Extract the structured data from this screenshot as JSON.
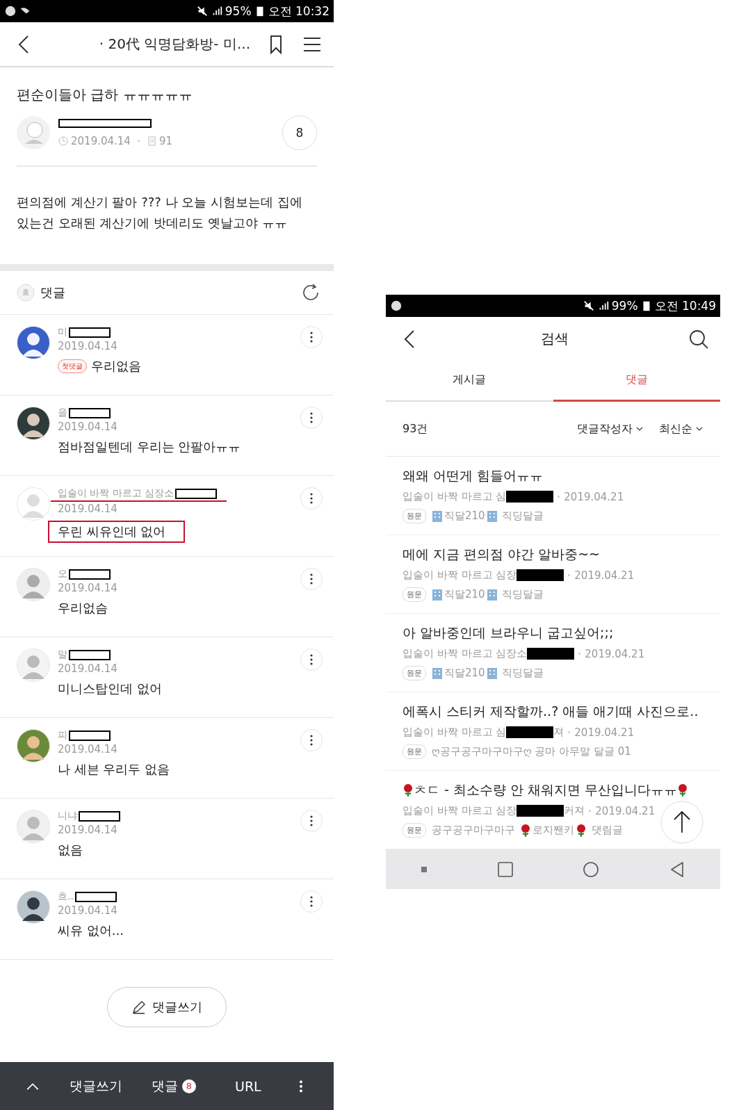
{
  "left": {
    "status_bar": {
      "battery": "95%",
      "time": "오전 10:32"
    },
    "header": {
      "title": "· 20代 익명담화방- 미..."
    },
    "post": {
      "title": "편순이들아 급하 ㅠㅠㅠㅠㅠ",
      "date": "2019.04.14",
      "views": "91",
      "comment_count": "8",
      "body": "편의점에 계산기 팔아 ??? 나 오늘 시험보는데 집에 있는건 오래된 계산기에 밧데리도 옛날고야 ㅠㅠ"
    },
    "comments_header": {
      "label": "댓글"
    },
    "comments": [
      {
        "name": "미",
        "date": "2019.04.14",
        "badge": "첫댓글",
        "text": "우리없음",
        "highlighted": false
      },
      {
        "name": "을",
        "date": "2019.04.14",
        "text": "점바점일텐데 우리는 안팔아ㅠㅠ",
        "highlighted": false
      },
      {
        "name": "입술이 바짝 마르고 심장소",
        "date": "2019.04.14",
        "text": "우린 씨유인데 없어",
        "highlighted": true
      },
      {
        "name": "오",
        "date": "2019.04.14",
        "text": "우리없슴",
        "highlighted": false
      },
      {
        "name": "말",
        "date": "2019.04.14",
        "text": "미니스탑인데 없어",
        "highlighted": false
      },
      {
        "name": "피",
        "date": "2019.04.14",
        "text": "나 세븐 우리두 없음",
        "highlighted": false
      },
      {
        "name": "니냐",
        "date": "2019.04.14",
        "text": "없음",
        "highlighted": false
      },
      {
        "name": "흐..",
        "date": "2019.04.14",
        "text": "씨유 없어...",
        "highlighted": false
      }
    ],
    "write_button": "댓글쓰기",
    "bottom_bar": {
      "write": "댓글쓰기",
      "comments": "댓글",
      "comments_badge": "8",
      "url": "URL"
    }
  },
  "right": {
    "status_bar": {
      "battery": "99%",
      "time": "오전 10:49"
    },
    "header": {
      "title": "검색"
    },
    "tabs": [
      {
        "label": "게시글",
        "selected": false
      },
      {
        "label": "댓글",
        "selected": true
      }
    ],
    "result_count": "93건",
    "filters": [
      "댓글작성자",
      "최신순"
    ],
    "results": [
      {
        "title": [
          {
            "text": "왜왜 어떤게 힘들어ㅠㅠ"
          }
        ],
        "author_before": "입술이 바짝 마르고 심",
        "date": "2019.04.21",
        "badge": "원문",
        "board": [
          {
            "kind": "emoji"
          },
          {
            "text": "직달210"
          },
          {
            "kind": "emoji"
          },
          {
            "text": " 직딩달글"
          }
        ]
      },
      {
        "title": [
          {
            "text": "메에 지금 편의점 야간 알바중~~"
          }
        ],
        "author_before": "입술이 바짝 마르고 심장",
        "date": "2019.04.21",
        "badge": "원문",
        "board": [
          {
            "kind": "emoji"
          },
          {
            "text": "직달210"
          },
          {
            "kind": "emoji"
          },
          {
            "text": " 직딩달글"
          }
        ]
      },
      {
        "title": [
          {
            "text": "아 알바중인데 브라우니 굽고싶어;;;"
          }
        ],
        "author_before": "입술이 바짝 마르고 심장소",
        "date": "2019.04.21",
        "badge": "원문",
        "board": [
          {
            "kind": "emoji"
          },
          {
            "text": "직달210"
          },
          {
            "kind": "emoji"
          },
          {
            "text": " 직딩달글"
          }
        ]
      },
      {
        "title": [
          {
            "text": "에폭시 스티커 제작할까..? 애들 애기때 사진으로.."
          }
        ],
        "author_before": "입술이 바짝 마르고 심",
        "author_after": "져",
        "date": "2019.04.21",
        "badge": "원문",
        "board": [
          {
            "text": "ღ공구공구마구마구ღ 공마 아무말 달글 01"
          }
        ]
      },
      {
        "title": [
          {
            "kind": "emoji"
          },
          {
            "text": " ㅊㄷ - 최소수량 안 채워지면 무산입니다ㅠㅠ"
          },
          {
            "kind": "emoji"
          }
        ],
        "author_before": "입술이 바짝 마르고 심장",
        "author_after": "커져",
        "date": "2019.04.21",
        "badge": "원문",
        "board": [
          {
            "text": "공구공구마구마구 "
          },
          {
            "kind": "emoji"
          },
          {
            "text": "로지짼키"
          },
          {
            "kind": "emoji"
          },
          {
            "text": " 댓림글"
          }
        ]
      }
    ]
  }
}
